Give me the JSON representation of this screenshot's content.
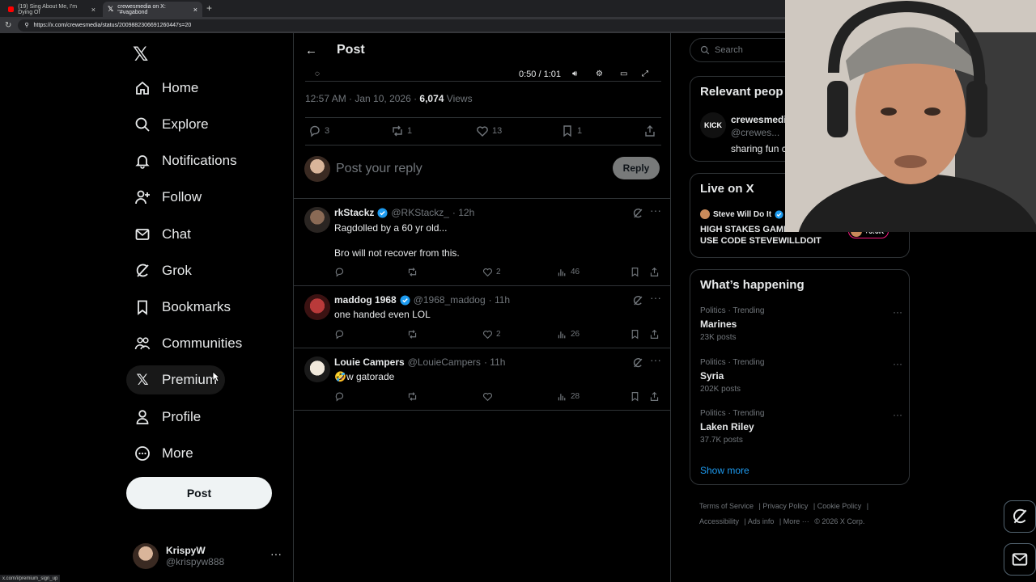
{
  "browser": {
    "tabs": [
      {
        "title": "(19) Sing About Me, I'm Dying Of",
        "active": false
      },
      {
        "title": "crewesmedia on X: \"#vagabond",
        "active": true
      }
    ],
    "url": "https://x.com/crewesmedia/status/2009882306691260447s=20"
  },
  "nav": {
    "items": [
      {
        "label": "Home",
        "icon": "home-icon"
      },
      {
        "label": "Explore",
        "icon": "search-icon"
      },
      {
        "label": "Notifications",
        "icon": "bell-icon"
      },
      {
        "label": "Follow",
        "icon": "follow-icon"
      },
      {
        "label": "Chat",
        "icon": "mail-icon"
      },
      {
        "label": "Grok",
        "icon": "grok-icon"
      },
      {
        "label": "Bookmarks",
        "icon": "bookmark-icon"
      },
      {
        "label": "Communities",
        "icon": "communities-icon"
      },
      {
        "label": "Premium",
        "icon": "x-icon"
      },
      {
        "label": "Profile",
        "icon": "profile-icon"
      },
      {
        "label": "More",
        "icon": "more-circle-icon"
      }
    ],
    "post_label": "Post",
    "account": {
      "name": "KrispyW",
      "handle": "@krispyw888"
    }
  },
  "status_url": "x.com/i/premium_sign_up",
  "main": {
    "header_title": "Post",
    "video_time": "0:50 / 1:01",
    "timestamp": "12:57 AM · Jan 10, 2026 · ",
    "views_count": "6,074",
    "views_label": " Views",
    "stats": {
      "replies": "3",
      "reposts": "1",
      "likes": "13",
      "bookmarks": "1"
    },
    "reply_placeholder": "Post your reply",
    "reply_button": "Reply",
    "replies": [
      {
        "name": "rkStackz",
        "handle": "@RKStackz_",
        "time": "· 12h",
        "verified": true,
        "lines": [
          "Ragdolled by a 60 yr old...",
          "Bro will not recover from this."
        ],
        "likes": "2",
        "views": "46"
      },
      {
        "name": "maddog 1968",
        "handle": "@1968_maddog",
        "time": "· 11h",
        "verified": true,
        "lines": [
          "one handed even LOL"
        ],
        "likes": "2",
        "views": "26"
      },
      {
        "name": "Louie Campers",
        "handle": "@LouieCampers",
        "time": "· 11h",
        "verified": false,
        "lines": [
          "🤣w gatorade"
        ],
        "likes": "",
        "views": "28"
      }
    ]
  },
  "right": {
    "search_placeholder": "Search",
    "relevant": {
      "title": "Relevant peop",
      "logo": "KICK",
      "name": "crewesmedia",
      "handle": "@crewes...",
      "bio": "sharing fun c"
    },
    "live": {
      "title": "Live on X",
      "host": "Steve Will Do It",
      "stream_title": "HIGH STAKES GAMBLING !! USE CODE STEVEWILLDOIT",
      "viewers": "+5.6K"
    },
    "happening": {
      "title": "What’s happening",
      "trends": [
        {
          "category": "Politics · Trending",
          "name": "Marines",
          "posts": "23K posts"
        },
        {
          "category": "Politics · Trending",
          "name": "Syria",
          "posts": "202K posts"
        },
        {
          "category": "Politics · Trending",
          "name": "Laken Riley",
          "posts": "37.7K posts"
        }
      ],
      "show_more": "Show more"
    },
    "footer": {
      "terms": "Terms of Service",
      "privacy": "Privacy Policy",
      "cookie": "Cookie Policy",
      "accessibility": "Accessibility",
      "ads": "Ads info",
      "more": "More ···",
      "copyright": "© 2026 X Corp."
    }
  },
  "colors": {
    "accent": "#1d9bf0",
    "like": "#f91880",
    "border": "#2f3336",
    "muted": "#71767b"
  }
}
